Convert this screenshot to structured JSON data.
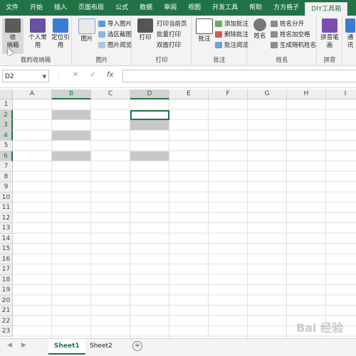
{
  "tabs": [
    "文件",
    "开始",
    "插入",
    "页面布局",
    "公式",
    "数据",
    "审阅",
    "视图",
    "开发工具",
    "帮助",
    "方方格子",
    "DIY工具箱"
  ],
  "active_tab": "DIY工具箱",
  "ribbon": {
    "group1": {
      "label": "我的收纳箱",
      "btn1": "收\n纳箱",
      "btn2": "个人常\n用",
      "btn3": "定位引\n用"
    },
    "group2": {
      "label": "图片",
      "btn1": "图片",
      "s1": "导入图片",
      "s2": "选区截图",
      "s3": "图片阅览"
    },
    "group3": {
      "label": "打印",
      "btn1": "打印",
      "s1": "打印当前页",
      "s2": "批量打印",
      "s3": "双面打印"
    },
    "group4": {
      "label": "批注",
      "btn1": "批注",
      "s1": "添加批注",
      "s2": "删除批注",
      "s3": "批注阅览"
    },
    "group5": {
      "label": "姓名",
      "btn1": "姓名",
      "s1": "姓名分开",
      "s2": "姓名加空格",
      "s3": "生成随机姓名"
    },
    "group6": {
      "label": "拼音",
      "btn1": "拼音笔\n画"
    },
    "group7": {
      "btn1": "通\n讯"
    }
  },
  "formula_bar": {
    "name_box": "D2",
    "cancel": "✕",
    "confirm": "✓",
    "fx": "fx",
    "content": ""
  },
  "columns": [
    "A",
    "B",
    "C",
    "D",
    "E",
    "F",
    "G",
    "H",
    "I"
  ],
  "rows": [
    "1",
    "2",
    "3",
    "4",
    "5",
    "6",
    "7",
    "8",
    "9",
    "10",
    "11",
    "12",
    "13",
    "14",
    "15",
    "16",
    "17",
    "18",
    "19",
    "20",
    "21",
    "22",
    "23"
  ],
  "selected_columns": [
    "B",
    "D"
  ],
  "selected_rows": [
    "2",
    "3",
    "4",
    "6"
  ],
  "active_cell": "D2",
  "sheets": [
    "Sheet1",
    "Sheet2"
  ],
  "active_sheet": "Sheet1",
  "watermark": "Bai 经验",
  "colors": {
    "accent": "#217346",
    "fill": "#c8c8c8"
  }
}
